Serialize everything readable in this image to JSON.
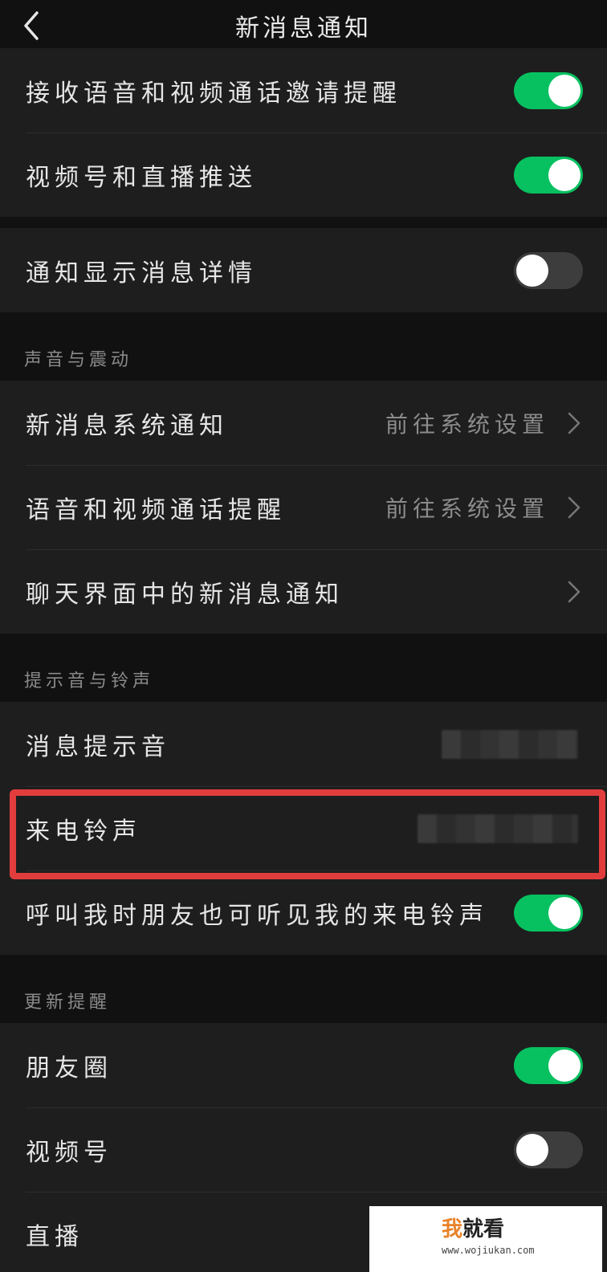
{
  "header": {
    "title": "新消息通知"
  },
  "section1": [
    {
      "label": "接收语音和视频通话邀请提醒",
      "toggle": true
    },
    {
      "label": "视频号和直播推送",
      "toggle": true
    }
  ],
  "section2": [
    {
      "label": "通知显示消息详情",
      "toggle": false
    }
  ],
  "sound_group": {
    "header": "声音与震动",
    "items": [
      {
        "label": "新消息系统通知",
        "value": "前往系统设置"
      },
      {
        "label": "语音和视频通话提醒",
        "value": "前往系统设置"
      },
      {
        "label": "聊天界面中的新消息通知",
        "value": ""
      }
    ]
  },
  "tone_group": {
    "header": "提示音与铃声",
    "items": [
      {
        "label": "消息提示音",
        "value_obscured": true
      },
      {
        "label": "来电铃声",
        "value_obscured": true,
        "highlighted": true
      },
      {
        "label": "呼叫我时朋友也可听见我的来电铃声",
        "toggle": true
      }
    ]
  },
  "update_group": {
    "header": "更新提醒",
    "items": [
      {
        "label": "朋友圈",
        "toggle": true
      },
      {
        "label": "视频号",
        "toggle": false
      },
      {
        "label": "直播"
      }
    ]
  },
  "watermark": {
    "brand_first": "我",
    "brand_rest": "就看",
    "domain": "www.wojiukan.com"
  },
  "colors": {
    "toggle_on": "#07c160",
    "toggle_off": "#3d3d3d",
    "highlight": "#e23d3d",
    "row_bg": "#1e1e1e",
    "page_bg": "#111111"
  }
}
